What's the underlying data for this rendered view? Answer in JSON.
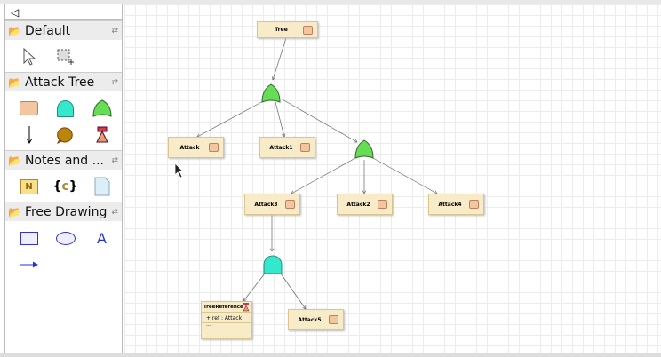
{
  "palette": {
    "collapse_icon": "triangle-left",
    "drawers": [
      {
        "label": "Default",
        "tools": [
          "select-arrow-icon",
          "marquee-select-icon"
        ]
      },
      {
        "label": "Attack Tree",
        "tools": [
          "attack-node-icon",
          "sand-gate-icon",
          "or-gate-icon",
          "edge-arrow-icon",
          "countermeasure-icon",
          "tree-reference-icon"
        ]
      },
      {
        "label": "Notes and ...",
        "tools": [
          "note-icon",
          "constraint-icon",
          "document-icon"
        ]
      },
      {
        "label": "Free Drawing",
        "tools": [
          "rectangle-icon",
          "ellipse-icon",
          "text-icon",
          "arrow-icon"
        ]
      }
    ]
  },
  "diagram": {
    "root": "Tree",
    "nodes": [
      "Attack",
      "Attack1",
      "Attack3",
      "Attack2",
      "Attack4",
      "Attack5"
    ],
    "tree_reference": {
      "title": "TreeReference",
      "ref": "+ ref : Attack ..."
    },
    "colors": {
      "or_gate": "#66dd55",
      "sand_gate": "#33ddc8",
      "node_fill": "#f8ecc8",
      "node_icon": "#f2c7a0"
    }
  }
}
